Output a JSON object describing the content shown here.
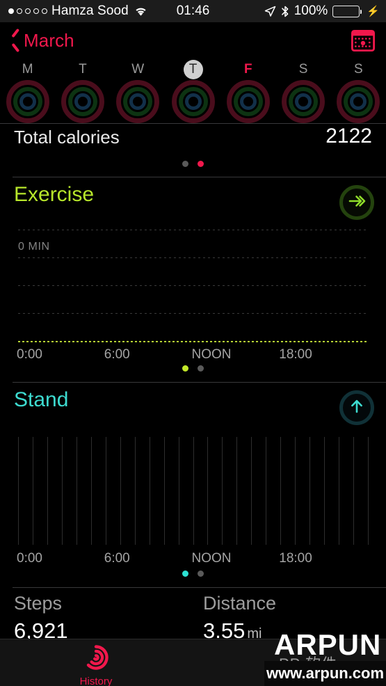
{
  "statusbar": {
    "signal_dots_filled": 1,
    "signal_dots_total": 5,
    "carrier": "Hamza Sood",
    "wifi_icon": "wifi-icon",
    "time": "01:46",
    "location_icon": "location-arrow-icon",
    "bluetooth_icon": "bluetooth-icon",
    "battery_percent": "100%",
    "battery_fill": 100,
    "charging_icon": "⚡",
    "battery_color": "#4cd964"
  },
  "navbar": {
    "back_label": "March",
    "back_icon": "chevron-left-icon",
    "calendar_icon": "calendar-icon",
    "accent_color": "#f1184c"
  },
  "week": {
    "days": [
      {
        "letter": "M",
        "selected": false,
        "accent": false
      },
      {
        "letter": "T",
        "selected": false,
        "accent": false
      },
      {
        "letter": "W",
        "selected": false,
        "accent": false
      },
      {
        "letter": "T",
        "selected": true,
        "accent": false
      },
      {
        "letter": "F",
        "selected": false,
        "accent": true
      },
      {
        "letter": "S",
        "selected": false,
        "accent": false
      },
      {
        "letter": "S",
        "selected": false,
        "accent": false
      }
    ],
    "ring_colors": {
      "move": "#4a0d1c",
      "exercise": "#0d3312",
      "stand": "#123049"
    }
  },
  "move_section": {
    "total_label": "Total calories",
    "total_value": "2122",
    "page_dots": {
      "count": 2,
      "active_index": 1,
      "active_color": "#f1184c"
    }
  },
  "exercise_section": {
    "title": "Exercise",
    "title_color": "#b7e62b",
    "badge_icon": "double-chevron-right-icon",
    "badge_color": "#8fdd2a",
    "page_dots": {
      "count": 2,
      "active_index": 0,
      "active_color": "#c3e829"
    },
    "chart_data": {
      "type": "bar",
      "title": "Exercise",
      "ylabel": "0 MIN",
      "ytick_labels": [
        "0 MIN"
      ],
      "xlabel": "",
      "x": [
        "0:00",
        "6:00",
        "NOON",
        "18:00"
      ],
      "xtick_positions_hours": [
        0,
        6,
        12,
        18
      ],
      "values": [
        0,
        0,
        0,
        0
      ],
      "ylim": [
        0,
        0
      ],
      "grid": true,
      "gridline_count": 4,
      "baseline_color": "#b6d434",
      "legend": "none"
    }
  },
  "stand_section": {
    "title": "Stand",
    "title_color": "#3ddbd0",
    "badge_icon": "arrow-up-icon",
    "badge_color": "#3ddbd0",
    "page_dots": {
      "count": 2,
      "active_index": 0,
      "active_color": "#2ce0d2"
    },
    "chart_data": {
      "type": "bar",
      "title": "Stand",
      "ylabel": "",
      "xlabel": "",
      "x": [
        "0:00",
        "6:00",
        "NOON",
        "18:00"
      ],
      "xtick_positions_hours": [
        0,
        6,
        12,
        18
      ],
      "hour_divisions": 24,
      "values": [
        0,
        0,
        0,
        0,
        0,
        0,
        0,
        0,
        0,
        0,
        0,
        0,
        0,
        0,
        0,
        0,
        0,
        0,
        0,
        0,
        0,
        0,
        0,
        0
      ],
      "ylim": [
        0,
        60
      ],
      "grid": true,
      "gridline_color": "#2e2e2e",
      "legend": "none"
    }
  },
  "stats": {
    "steps": {
      "label": "Steps",
      "value": "6,921"
    },
    "distance": {
      "label": "Distance",
      "value": "3.55",
      "unit": "mi"
    }
  },
  "tabbar": {
    "items": [
      {
        "label": "History",
        "icon": "activity-spiral-icon",
        "active": true,
        "color": "#f1184c"
      }
    ]
  },
  "watermark": {
    "brand": "ARPUN",
    "subtitle": "PP 软件",
    "url": "www.arpun.com"
  }
}
